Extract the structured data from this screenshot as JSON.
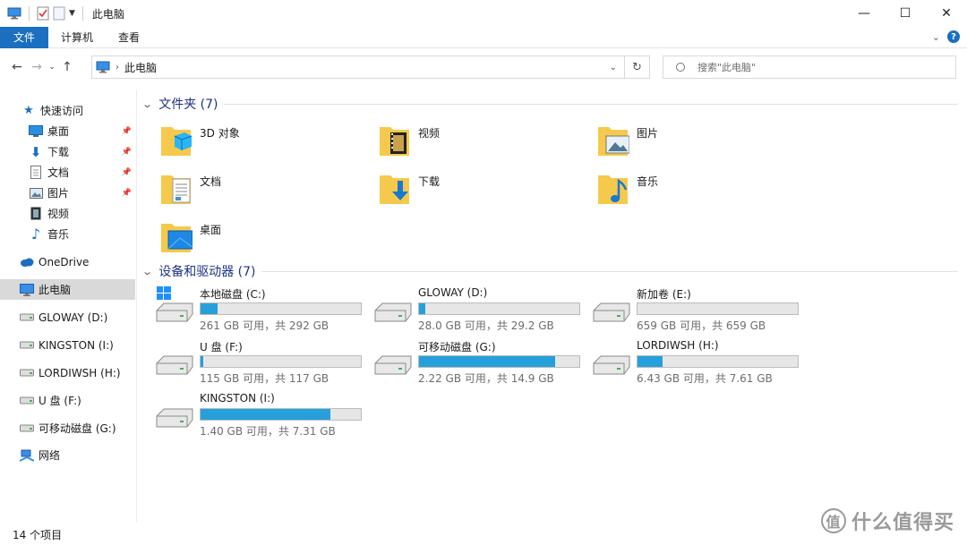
{
  "window": {
    "title": "此电脑",
    "controls": {
      "minimize": "—",
      "maximize": "☐",
      "close": "✕"
    }
  },
  "ribbon": {
    "tabs": [
      {
        "label": "文件",
        "active": true
      },
      {
        "label": "计算机"
      },
      {
        "label": "查看"
      }
    ]
  },
  "address_bar": {
    "path": "此电脑",
    "search_placeholder": "搜索\"此电脑\""
  },
  "sidebar": {
    "quick_access": "快速访问",
    "quick_items": [
      {
        "label": "桌面",
        "icon": "desktop-icon",
        "pinned": true
      },
      {
        "label": "下载",
        "icon": "download-icon",
        "pinned": true
      },
      {
        "label": "文档",
        "icon": "document-icon",
        "pinned": true
      },
      {
        "label": "图片",
        "icon": "picture-icon",
        "pinned": true
      },
      {
        "label": "视频",
        "icon": "video-icon",
        "pinned": false
      },
      {
        "label": "音乐",
        "icon": "music-icon",
        "pinned": false
      }
    ],
    "onedrive": "OneDrive",
    "this_pc": "此电脑",
    "drives": [
      "GLOWAY (D:)",
      "KINGSTON (I:)",
      "LORDIWSH (H:)",
      "U 盘 (F:)",
      "可移动磁盘 (G:)"
    ],
    "network": "网络"
  },
  "folders": {
    "heading": "文件夹 (7)",
    "items": [
      {
        "label": "3D 对象",
        "icon": "3d-objects-icon"
      },
      {
        "label": "视频",
        "icon": "video-icon"
      },
      {
        "label": "图片",
        "icon": "picture-icon"
      },
      {
        "label": "文档",
        "icon": "document-icon"
      },
      {
        "label": "下载",
        "icon": "download-icon"
      },
      {
        "label": "音乐",
        "icon": "music-icon"
      },
      {
        "label": "桌面",
        "icon": "desktop-icon"
      }
    ]
  },
  "devices": {
    "heading": "设备和驱动器 (7)",
    "items": [
      {
        "label": "本地磁盘 (C:)",
        "info": "261 GB 可用，共 292 GB",
        "used_fraction": 0.106,
        "windows": true
      },
      {
        "label": "GLOWAY (D:)",
        "info": "28.0 GB 可用，共 29.2 GB",
        "used_fraction": 0.041
      },
      {
        "label": "新加卷 (E:)",
        "info": "659 GB 可用，共 659 GB",
        "used_fraction": 0.0
      },
      {
        "label": "U 盘 (F:)",
        "info": "115 GB 可用，共 117 GB",
        "used_fraction": 0.017
      },
      {
        "label": "可移动磁盘 (G:)",
        "info": "2.22 GB 可用，共 14.9 GB",
        "used_fraction": 0.851
      },
      {
        "label": "LORDIWSH (H:)",
        "info": "6.43 GB 可用，共 7.61 GB",
        "used_fraction": 0.155
      },
      {
        "label": "KINGSTON (I:)",
        "info": "1.40 GB 可用，共 7.31 GB",
        "used_fraction": 0.808
      }
    ]
  },
  "status": {
    "count": "14 个项目"
  },
  "watermark": {
    "glyph": "值",
    "text": "什么值得买"
  },
  "colors": {
    "accent": "#1a6fc1",
    "bar_fill": "#26a0da",
    "heading": "#1e3287"
  }
}
